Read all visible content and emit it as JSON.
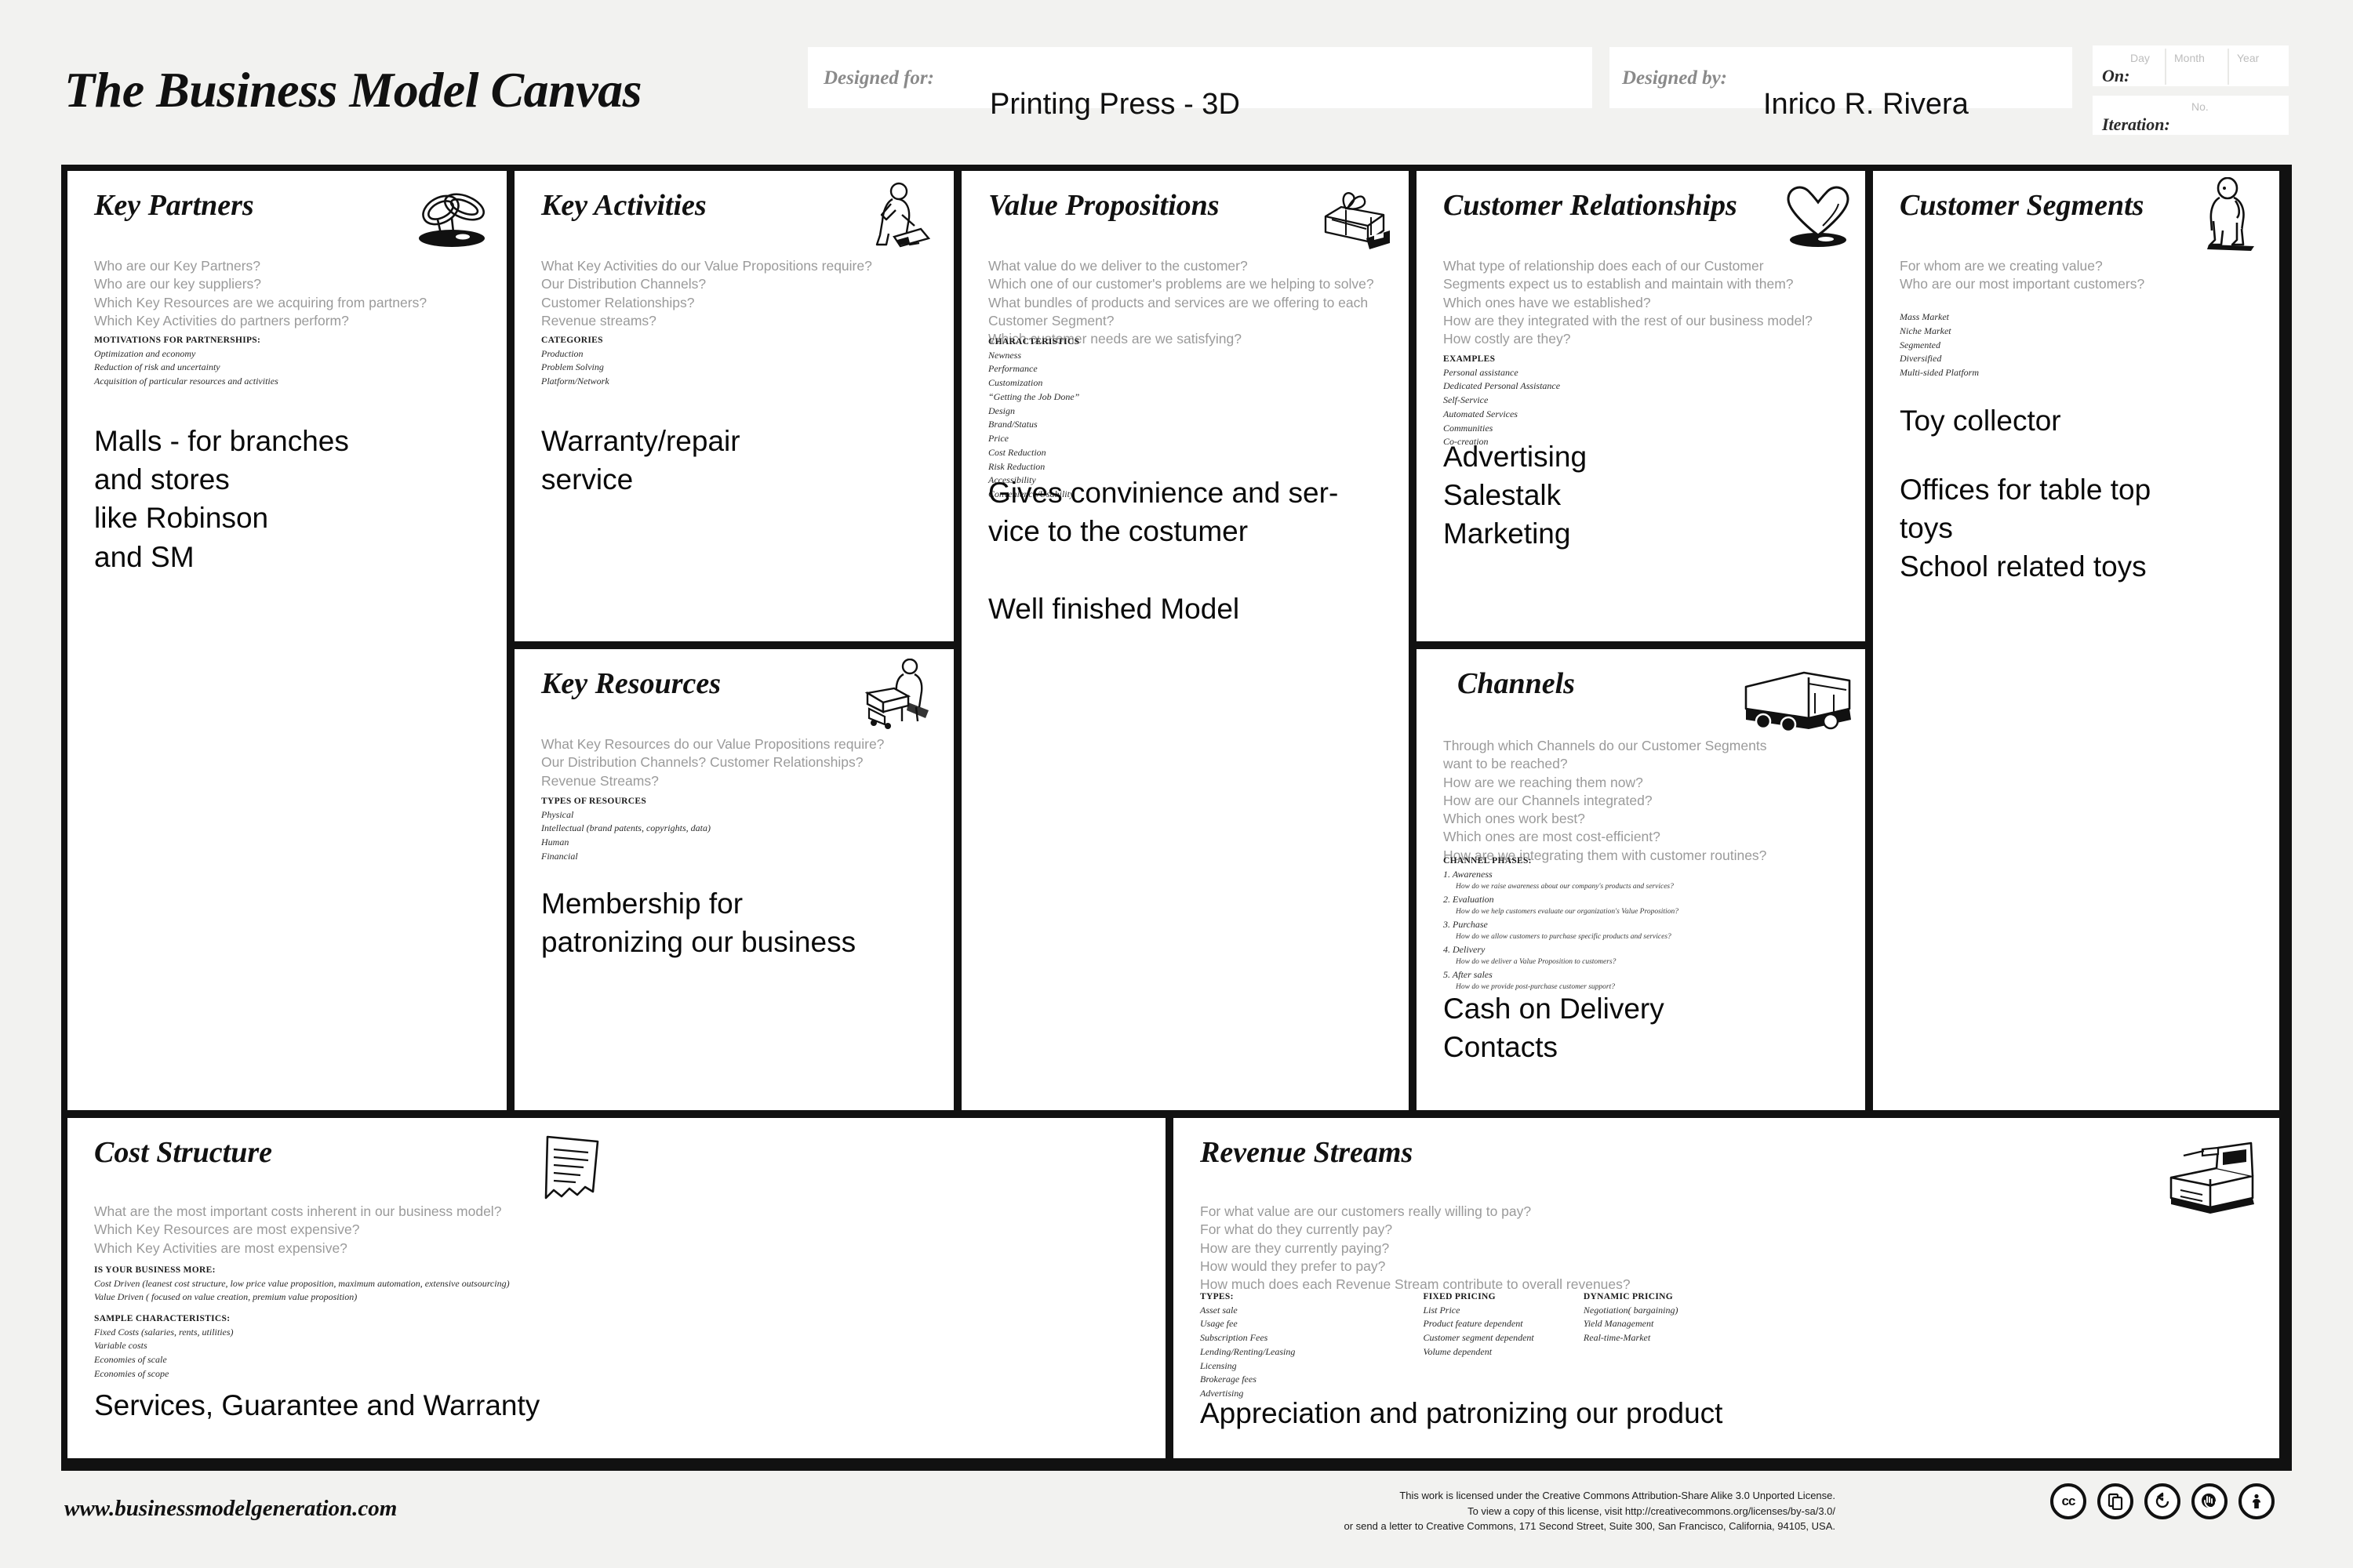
{
  "header": {
    "title": "The Business Model Canvas",
    "designed_for_label": "Designed for:",
    "designed_for_value": "Printing Press - 3D",
    "designed_by_label": "Designed by:",
    "designed_by_value": "Inrico R. Rivera",
    "on_label": "On:",
    "on_day": "Day",
    "on_month": "Month",
    "on_year": "Year",
    "iteration_label": "Iteration:",
    "iteration_no": "No."
  },
  "blocks": {
    "key_partners": {
      "title": "Key Partners",
      "icon": "chain-links-icon",
      "prompts": "Who are our Key Partners?\nWho are our key suppliers?\nWhich Key Resources are we acquiring from partners?\nWhich Key Activities do partners perform?",
      "fine_head": "MOTIVATIONS FOR PARTNERSHIPS:",
      "fine_items": [
        "Optimization and economy",
        "Reduction of risk and uncertainty",
        "Acquisition of particular resources and activities"
      ],
      "user_text": "Malls - for branches\nand stores\nlike Robinson\nand SM"
    },
    "key_activities": {
      "title": "Key Activities",
      "icon": "worker-hammer-icon",
      "prompts": "What Key Activities do our Value Propositions require?\nOur Distribution Channels?\nCustomer Relationships?\nRevenue streams?",
      "fine_head": "CATEGORIES",
      "fine_items": [
        "Production",
        "Problem Solving",
        "Platform/Network"
      ],
      "user_text": "Warranty/repair\nservice"
    },
    "key_resources": {
      "title": "Key Resources",
      "icon": "worker-crate-icon",
      "prompts": "What Key Resources do our Value Propositions require?\nOur Distribution Channels? Customer Relationships?\nRevenue Streams?",
      "fine_head": "TYPES OF RESOURCES",
      "fine_items": [
        "Physical",
        "Intellectual (brand patents, copyrights, data)",
        "Human",
        "Financial"
      ],
      "user_text": "Membership for\npatronizing our business"
    },
    "value_propositions": {
      "title": "Value Propositions",
      "icon": "gift-box-icon",
      "prompts": "What value do we deliver to the customer?\nWhich one of our customer's problems are we helping to solve?\nWhat bundles of products and services are we offering to each Customer Segment?\nWhich customer needs are we satisfying?",
      "fine_head": "CHARACTERISTICS",
      "fine_items": [
        "Newness",
        "Performance",
        "Customization",
        "“Getting the Job Done”",
        "Design",
        "Brand/Status",
        "Price",
        "Cost Reduction",
        "Risk Reduction",
        "Accessibility",
        "Convenience/Usability"
      ],
      "user_text": "Gives convinience and ser-\nvice to the costumer\n\nWell finished Model"
    },
    "customer_relationships": {
      "title": "Customer Relationships",
      "icon": "heart-icon",
      "prompts": "What type of relationship does each of our Customer\nSegments expect us to establish and maintain with them?\nWhich ones have we established?\nHow are they integrated with the rest of our business model?\nHow costly are they?",
      "fine_head": "EXAMPLES",
      "fine_items": [
        "Personal assistance",
        "Dedicated Personal Assistance",
        "Self-Service",
        "Automated Services",
        "Communities",
        "Co-creation"
      ],
      "user_text": "Advertising\nSalestalk\nMarketing"
    },
    "channels": {
      "title": "Channels",
      "icon": "delivery-truck-icon",
      "prompts": "Through which Channels do our Customer Segments\nwant to be reached?\nHow are we reaching them now?\nHow are our Channels integrated?\nWhich ones work best?\nWhich ones are most cost-efficient?\nHow are we integrating them with customer routines?",
      "fine_head": "CHANNEL PHASES:",
      "phases": [
        {
          "name": "1. Awareness",
          "desc": "How do we raise awareness about our company's products and services?"
        },
        {
          "name": "2. Evaluation",
          "desc": "How do we help customers evaluate our organization's Value Proposition?"
        },
        {
          "name": "3. Purchase",
          "desc": "How do we allow customers to purchase specific products and services?"
        },
        {
          "name": "4. Delivery",
          "desc": "How do we deliver a Value Proposition to customers?"
        },
        {
          "name": "5. After sales",
          "desc": "How do we provide post-purchase customer support?"
        }
      ],
      "user_text": "Cash on Delivery\nContacts"
    },
    "customer_segments": {
      "title": "Customer Segments",
      "icon": "standing-person-icon",
      "prompts": "For whom are we creating value?\nWho are our most important customers?",
      "fine_head": "",
      "fine_items": [
        "Mass Market",
        "Niche Market",
        "Segmented",
        "Diversified",
        "Multi-sided Platform"
      ],
      "user_text_primary": "Toy collector",
      "user_text_secondary": "Offices for table top\ntoys\nSchool related toys"
    },
    "cost_structure": {
      "title": "Cost Structure",
      "icon": "invoice-page-icon",
      "prompts": "What are the most important costs inherent in our business model?\nWhich Key Resources are most expensive?\nWhich Key Activities are most expensive?",
      "fine_head_1": "IS YOUR BUSINESS MORE:",
      "fine_items_1": [
        "Cost Driven (leanest cost structure, low price value proposition, maximum automation, extensive outsourcing)",
        "Value Driven ( focused on value creation, premium value proposition)"
      ],
      "fine_head_2": "SAMPLE CHARACTERISTICS:",
      "fine_items_2": [
        "Fixed Costs (salaries, rents, utilities)",
        "Variable costs",
        "Economies of scale",
        "Economies of scope"
      ],
      "user_text": "Services, Guarantee and Warranty"
    },
    "revenue_streams": {
      "title": "Revenue Streams",
      "icon": "cash-register-icon",
      "prompts": "For what value are our customers really willing to pay?\nFor what do they currently pay?\nHow are they currently paying?\nHow would they prefer to pay?\nHow much does each Revenue Stream contribute to overall revenues?",
      "columns": [
        {
          "head": "TYPES:",
          "items": [
            "Asset sale",
            "Usage fee",
            "Subscription Fees",
            "Lending/Renting/Leasing",
            "Licensing",
            "Brokerage fees",
            "Advertising"
          ]
        },
        {
          "head": "FIXED PRICING",
          "items": [
            "List Price",
            "Product feature dependent",
            "Customer segment dependent",
            "Volume dependent"
          ]
        },
        {
          "head": "DYNAMIC PRICING",
          "items": [
            "Negotiation( bargaining)",
            "Yield Management",
            "Real-time-Market"
          ]
        }
      ],
      "user_text": "Appreciation and patronizing our product"
    }
  },
  "footer": {
    "url": "www.businessmodelgeneration.com",
    "license_line_1": "This work is licensed under the Creative Commons Attribution-Share Alike 3.0 Unported License.",
    "license_line_2": "To view a copy of this license, visit http://creativecommons.org/licenses/by-sa/3.0/",
    "license_line_3": "or send a letter to Creative Commons, 171 Second Street, Suite 300, San Francisco, California, 94105, USA.",
    "badges": [
      "cc-icon",
      "copy-icon",
      "share-alike-icon",
      "attribution-hand-icon",
      "person-icon"
    ]
  },
  "colors": {
    "page_bg": "#f2f2f0",
    "cell_bg": "#ffffff",
    "grid_line": "#111111",
    "prompt_text": "#9a9a9a",
    "user_text": "#0a0a0a"
  }
}
